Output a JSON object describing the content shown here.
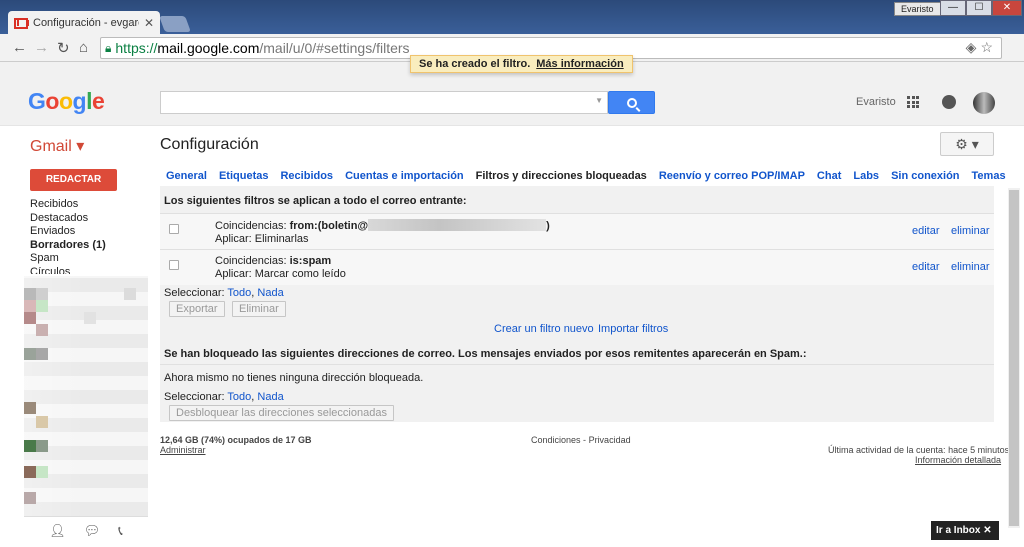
{
  "browser": {
    "tab_title": "Configuración - evgarcia:",
    "tab_close": "✕",
    "profile_name": "Evaristo",
    "window_minimize": "—",
    "window_maximize": "☐",
    "window_close": "✕",
    "url_scheme": "https://",
    "url_host": "mail.google.com",
    "url_path": "/mail/u/0/#settings/filters"
  },
  "header": {
    "logo": "Google",
    "user_name": "Evaristo",
    "toast_text": "Se ha creado el filtro.",
    "toast_link": "Más información"
  },
  "subheader": {
    "brand": "Gmail ▾",
    "title": "Configuración",
    "gear": "⚙ ▾"
  },
  "sidebar": {
    "compose_label": "REDACTAR",
    "items": [
      {
        "label": "Recibidos"
      },
      {
        "label": "Destacados"
      },
      {
        "label": "Enviados"
      },
      {
        "label": "Borradores (1)"
      },
      {
        "label": "Spam"
      },
      {
        "label": "Círculos"
      }
    ]
  },
  "settings_tabs": [
    {
      "label": "General"
    },
    {
      "label": "Etiquetas"
    },
    {
      "label": "Recibidos"
    },
    {
      "label": "Cuentas e importación"
    },
    {
      "label": "Filtros y direcciones bloqueadas"
    },
    {
      "label": "Reenvío y correo POP/IMAP"
    },
    {
      "label": "Chat"
    },
    {
      "label": "Labs"
    },
    {
      "label": "Sin conexión"
    },
    {
      "label": "Temas"
    }
  ],
  "filters": {
    "section_title": "Los siguientes filtros se aplican a todo el correo entrante:",
    "rows": [
      {
        "match_prefix": "Coincidencias:",
        "match_value": "from:(boletin@",
        "match_suffix": ")",
        "action": "Aplicar: Eliminarlas",
        "edit": "editar",
        "delete": "eliminar"
      },
      {
        "match_prefix": "Coincidencias:",
        "match_value": "is:spam",
        "match_suffix": "",
        "action": "Aplicar: Marcar como leído",
        "edit": "editar",
        "delete": "eliminar"
      }
    ],
    "select_label": "Seleccionar:",
    "select_all": "Todo",
    "select_none": "Nada",
    "export_button": "Exportar",
    "delete_button": "Eliminar",
    "create_filter": "Crear un filtro nuevo",
    "import_filters": "Importar filtros"
  },
  "blocked": {
    "section_title": "Se han bloqueado las siguientes direcciones de correo. Los mensajes enviados por esos remitentes aparecerán en Spam.:",
    "empty_text": "Ahora mismo no tienes ninguna dirección bloqueada.",
    "select_label": "Seleccionar:",
    "select_all": "Todo",
    "select_none": "Nada",
    "unblock_button": "Desbloquear las direcciones seleccionadas"
  },
  "footer": {
    "storage": "12,64 GB (74%) ocupados de 17 GB",
    "manage": "Administrar",
    "terms": "Condiciones",
    "sep": "-",
    "privacy": "Privacidad",
    "last_activity": "Última actividad de la cuenta: hace 5 minutos",
    "details": "Información detallada"
  },
  "inbox_promo": "Ir a Inbox ✕",
  "colors": {
    "accent_red": "#dd4b39",
    "link_blue": "#1155cc",
    "search_blue": "#4285f4"
  }
}
